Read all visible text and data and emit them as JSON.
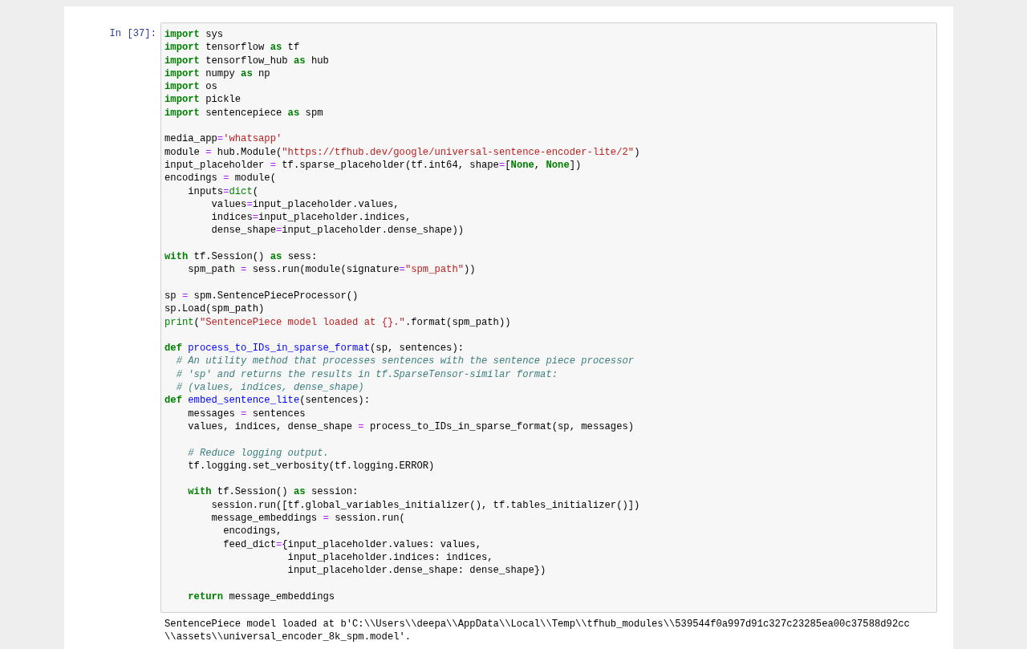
{
  "cell": {
    "prompt": "In [37]:",
    "code_lines": [
      {
        "kind": "code",
        "tokens": [
          {
            "kind": "keyword",
            "text": "import"
          },
          {
            "kind": "plain",
            "text": " sys"
          }
        ]
      },
      {
        "kind": "code",
        "tokens": [
          {
            "kind": "keyword",
            "text": "import"
          },
          {
            "kind": "plain",
            "text": " tensorflow "
          },
          {
            "kind": "keyword",
            "text": "as"
          },
          {
            "kind": "plain",
            "text": " tf"
          }
        ]
      },
      {
        "kind": "code",
        "tokens": [
          {
            "kind": "keyword",
            "text": "import"
          },
          {
            "kind": "plain",
            "text": " tensorflow_hub "
          },
          {
            "kind": "keyword",
            "text": "as"
          },
          {
            "kind": "plain",
            "text": " hub"
          }
        ]
      },
      {
        "kind": "code",
        "tokens": [
          {
            "kind": "keyword",
            "text": "import"
          },
          {
            "kind": "plain",
            "text": " numpy "
          },
          {
            "kind": "keyword",
            "text": "as"
          },
          {
            "kind": "plain",
            "text": " np"
          }
        ]
      },
      {
        "kind": "code",
        "tokens": [
          {
            "kind": "keyword",
            "text": "import"
          },
          {
            "kind": "plain",
            "text": " os"
          }
        ]
      },
      {
        "kind": "code",
        "tokens": [
          {
            "kind": "keyword",
            "text": "import"
          },
          {
            "kind": "plain",
            "text": " pickle"
          }
        ]
      },
      {
        "kind": "code",
        "tokens": [
          {
            "kind": "keyword",
            "text": "import"
          },
          {
            "kind": "plain",
            "text": " sentencepiece "
          },
          {
            "kind": "keyword",
            "text": "as"
          },
          {
            "kind": "plain",
            "text": " spm"
          }
        ]
      },
      {
        "kind": "blank"
      },
      {
        "kind": "code",
        "tokens": [
          {
            "kind": "plain",
            "text": "media_app"
          },
          {
            "kind": "operator",
            "text": "="
          },
          {
            "kind": "string",
            "text": "'whatsapp'"
          }
        ]
      },
      {
        "kind": "code",
        "tokens": [
          {
            "kind": "plain",
            "text": "module "
          },
          {
            "kind": "operator",
            "text": "="
          },
          {
            "kind": "plain",
            "text": " hub.Module("
          },
          {
            "kind": "string",
            "text": "\"https://tfhub.dev/google/universal-sentence-encoder-lite/2\""
          },
          {
            "kind": "plain",
            "text": ")"
          }
        ]
      },
      {
        "kind": "code",
        "tokens": [
          {
            "kind": "plain",
            "text": "input_placeholder "
          },
          {
            "kind": "operator",
            "text": "="
          },
          {
            "kind": "plain",
            "text": " tf.sparse_placeholder(tf.int64, shape"
          },
          {
            "kind": "operator",
            "text": "="
          },
          {
            "kind": "plain",
            "text": "["
          },
          {
            "kind": "keyword",
            "text": "None"
          },
          {
            "kind": "plain",
            "text": ", "
          },
          {
            "kind": "keyword",
            "text": "None"
          },
          {
            "kind": "plain",
            "text": "])"
          }
        ]
      },
      {
        "kind": "code",
        "tokens": [
          {
            "kind": "plain",
            "text": "encodings "
          },
          {
            "kind": "operator",
            "text": "="
          },
          {
            "kind": "plain",
            "text": " module("
          }
        ]
      },
      {
        "kind": "code",
        "tokens": [
          {
            "kind": "plain",
            "text": "    inputs"
          },
          {
            "kind": "operator",
            "text": "="
          },
          {
            "kind": "builtin",
            "text": "dict"
          },
          {
            "kind": "plain",
            "text": "("
          }
        ]
      },
      {
        "kind": "code",
        "tokens": [
          {
            "kind": "plain",
            "text": "        values"
          },
          {
            "kind": "operator",
            "text": "="
          },
          {
            "kind": "plain",
            "text": "input_placeholder.values,"
          }
        ]
      },
      {
        "kind": "code",
        "tokens": [
          {
            "kind": "plain",
            "text": "        indices"
          },
          {
            "kind": "operator",
            "text": "="
          },
          {
            "kind": "plain",
            "text": "input_placeholder.indices,"
          }
        ]
      },
      {
        "kind": "code",
        "tokens": [
          {
            "kind": "plain",
            "text": "        dense_shape"
          },
          {
            "kind": "operator",
            "text": "="
          },
          {
            "kind": "plain",
            "text": "input_placeholder.dense_shape))"
          }
        ]
      },
      {
        "kind": "blank"
      },
      {
        "kind": "code",
        "tokens": [
          {
            "kind": "keyword",
            "text": "with"
          },
          {
            "kind": "plain",
            "text": " tf.Session() "
          },
          {
            "kind": "keyword",
            "text": "as"
          },
          {
            "kind": "plain",
            "text": " sess:"
          }
        ]
      },
      {
        "kind": "code",
        "tokens": [
          {
            "kind": "plain",
            "text": "    spm_path "
          },
          {
            "kind": "operator",
            "text": "="
          },
          {
            "kind": "plain",
            "text": " sess.run(module(signature"
          },
          {
            "kind": "operator",
            "text": "="
          },
          {
            "kind": "string",
            "text": "\"spm_path\""
          },
          {
            "kind": "plain",
            "text": "))"
          }
        ]
      },
      {
        "kind": "blank"
      },
      {
        "kind": "code",
        "tokens": [
          {
            "kind": "plain",
            "text": "sp "
          },
          {
            "kind": "operator",
            "text": "="
          },
          {
            "kind": "plain",
            "text": " spm.SentencePieceProcessor()"
          }
        ]
      },
      {
        "kind": "code",
        "tokens": [
          {
            "kind": "plain",
            "text": "sp.Load(spm_path)"
          }
        ]
      },
      {
        "kind": "code",
        "tokens": [
          {
            "kind": "builtin",
            "text": "print"
          },
          {
            "kind": "plain",
            "text": "("
          },
          {
            "kind": "string",
            "text": "\"SentencePiece model loaded at {}.\""
          },
          {
            "kind": "plain",
            "text": ".format(spm_path))"
          }
        ]
      },
      {
        "kind": "blank"
      },
      {
        "kind": "code",
        "tokens": [
          {
            "kind": "keyword",
            "text": "def"
          },
          {
            "kind": "function",
            "text": " process_to_IDs_in_sparse_format"
          },
          {
            "kind": "plain",
            "text": "(sp, sentences):"
          }
        ]
      },
      {
        "kind": "code",
        "tokens": [
          {
            "kind": "comment",
            "text": "  # An utility method that processes sentences with the sentence piece processor"
          }
        ]
      },
      {
        "kind": "code",
        "tokens": [
          {
            "kind": "comment",
            "text": "  # 'sp' and returns the results in tf.SparseTensor-similar format:"
          }
        ]
      },
      {
        "kind": "code",
        "tokens": [
          {
            "kind": "comment",
            "text": "  # (values, indices, dense_shape)"
          }
        ]
      },
      {
        "kind": "code",
        "tokens": [
          {
            "kind": "keyword",
            "text": "def"
          },
          {
            "kind": "function",
            "text": " embed_sentence_lite"
          },
          {
            "kind": "plain",
            "text": "(sentences):"
          }
        ]
      },
      {
        "kind": "code",
        "tokens": [
          {
            "kind": "plain",
            "text": "    messages "
          },
          {
            "kind": "operator",
            "text": "="
          },
          {
            "kind": "plain",
            "text": " sentences"
          }
        ]
      },
      {
        "kind": "code",
        "tokens": [
          {
            "kind": "plain",
            "text": "    values, indices, dense_shape "
          },
          {
            "kind": "operator",
            "text": "="
          },
          {
            "kind": "plain",
            "text": " process_to_IDs_in_sparse_format(sp, messages)"
          }
        ]
      },
      {
        "kind": "blank"
      },
      {
        "kind": "code",
        "tokens": [
          {
            "kind": "comment",
            "text": "    # Reduce logging output."
          }
        ]
      },
      {
        "kind": "code",
        "tokens": [
          {
            "kind": "plain",
            "text": "    tf.logging.set_verbosity(tf.logging.ERROR)"
          }
        ]
      },
      {
        "kind": "blank"
      },
      {
        "kind": "code",
        "tokens": [
          {
            "kind": "keyword",
            "text": "    with"
          },
          {
            "kind": "plain",
            "text": " tf.Session() "
          },
          {
            "kind": "keyword",
            "text": "as"
          },
          {
            "kind": "plain",
            "text": " session:"
          }
        ]
      },
      {
        "kind": "code",
        "tokens": [
          {
            "kind": "plain",
            "text": "        session.run([tf.global_variables_initializer(), tf.tables_initializer()])"
          }
        ]
      },
      {
        "kind": "code",
        "tokens": [
          {
            "kind": "plain",
            "text": "        message_embeddings "
          },
          {
            "kind": "operator",
            "text": "="
          },
          {
            "kind": "plain",
            "text": " session.run("
          }
        ]
      },
      {
        "kind": "code",
        "tokens": [
          {
            "kind": "plain",
            "text": "          encodings,"
          }
        ]
      },
      {
        "kind": "code",
        "tokens": [
          {
            "kind": "plain",
            "text": "          feed_dict"
          },
          {
            "kind": "operator",
            "text": "="
          },
          {
            "kind": "plain",
            "text": "{input_placeholder.values: values,"
          }
        ]
      },
      {
        "kind": "code",
        "tokens": [
          {
            "kind": "plain",
            "text": "                     input_placeholder.indices: indices,"
          }
        ]
      },
      {
        "kind": "code",
        "tokens": [
          {
            "kind": "plain",
            "text": "                     input_placeholder.dense_shape: dense_shape})"
          }
        ]
      },
      {
        "kind": "blank"
      },
      {
        "kind": "code",
        "tokens": [
          {
            "kind": "keyword",
            "text": "    return"
          },
          {
            "kind": "plain",
            "text": " message_embeddings"
          }
        ]
      }
    ],
    "output_lines": [
      "SentencePiece model loaded at b'C:\\\\Users\\\\deepa\\\\AppData\\\\Local\\\\Temp\\\\tfhub_modules\\\\539544f0a997d91c327c23285ea00c37588d92cc",
      "\\\\assets\\\\universal_encoder_8k_spm.model'."
    ]
  }
}
